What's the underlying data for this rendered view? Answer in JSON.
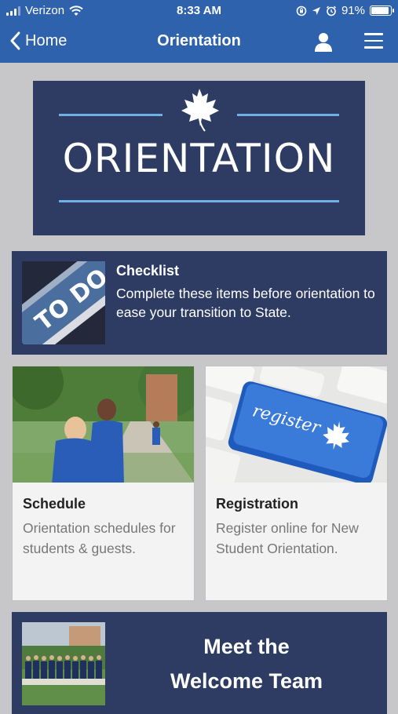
{
  "status_bar": {
    "carrier": "Verizon",
    "time": "8:33 AM",
    "battery": "91%",
    "battery_level": 0.91
  },
  "nav": {
    "back_label": "Home",
    "title": "Orientation"
  },
  "hero": {
    "title": "ORIENTATION"
  },
  "checklist": {
    "title": "Checklist",
    "description": "Complete these items before orientation to ease your transition to State.",
    "thumb_text": "TO DO"
  },
  "tiles": [
    {
      "title": "Schedule",
      "description": "Orientation schedules for students & guests."
    },
    {
      "title": "Registration",
      "description": "Register online for New Student Orientation.",
      "key_text": "register"
    }
  ],
  "welcome": {
    "title_line1": "Meet the",
    "title_line2": "Welcome Team"
  },
  "colors": {
    "nav_blue": "#2f62ad",
    "card_navy": "#2e3c63",
    "hero_accent": "#6eb0e8",
    "background": "#c7c7c9"
  }
}
